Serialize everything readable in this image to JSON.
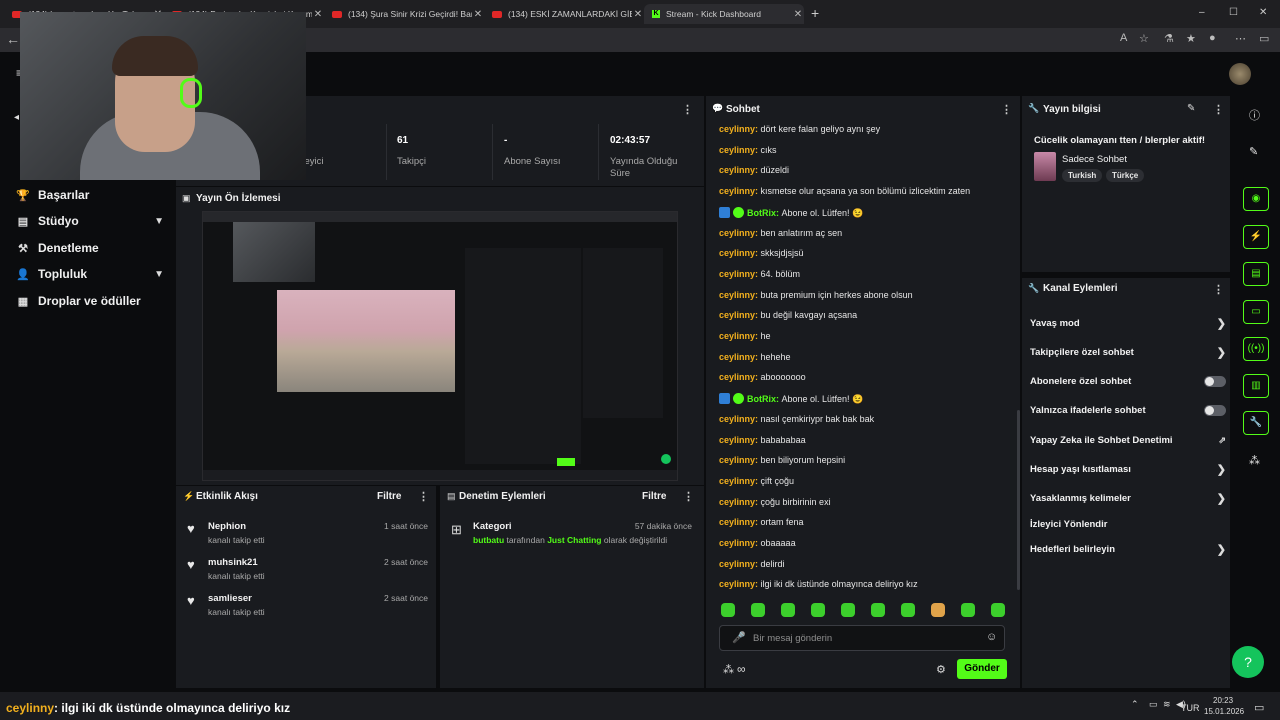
{
  "browser": {
    "tabs": [
      {
        "label": "(134) kısmetse olur - YouTube",
        "icon": "youtube-icon"
      },
      {
        "label": "(134) Perinaz'ın Kaprisleri Kerem'i",
        "icon": "youtube-icon"
      },
      {
        "label": "(134) Şura Sinir Krizi Geçirdi! Bard",
        "icon": "youtube-icon"
      },
      {
        "label": "(134) ESKİ ZAMANLARDAKİ GİBİ",
        "icon": "youtube-icon"
      },
      {
        "label": "Stream - Kick Dashboard",
        "icon": "kick-icon"
      }
    ],
    "new_tab": "+",
    "window_controls": [
      "–",
      "☐",
      "✕"
    ]
  },
  "sidebar": {
    "items": [
      {
        "label": "Başarılar",
        "icon": "trophy-icon",
        "expandable": false
      },
      {
        "label": "Stüdyo",
        "icon": "studio-icon",
        "expandable": true
      },
      {
        "label": "Denetleme",
        "icon": "hammer-icon",
        "expandable": false
      },
      {
        "label": "Topluluk",
        "icon": "community-icon",
        "expandable": true
      },
      {
        "label": "Droplar ve ödüller",
        "icon": "gift-icon",
        "expandable": false
      }
    ]
  },
  "stats": [
    {
      "value": "",
      "label": "İzleyici"
    },
    {
      "value": "61",
      "label": "Takipçi"
    },
    {
      "value": "-",
      "label": "Abone Sayısı"
    },
    {
      "value": "02:43:57",
      "label": "Yayında Olduğu Süre"
    }
  ],
  "preview": {
    "title": "Yayın Ön İzlemesi"
  },
  "activity": {
    "title": "Etkinlik Akışı",
    "filter": "Filtre",
    "events": [
      {
        "name": "Nephion",
        "action": "kanalı takip etti",
        "time": "1 saat önce"
      },
      {
        "name": "muhsink21",
        "action": "kanalı takip etti",
        "time": "2 saat önce"
      },
      {
        "name": "samlieser",
        "action": "kanalı takip etti",
        "time": "2 saat önce"
      }
    ]
  },
  "moderation": {
    "title": "Denetim Eylemleri",
    "filter": "Filtre",
    "entries": [
      {
        "title": "Kategori",
        "time": "57 dakika önce",
        "user": "butbatu",
        "mid": " tarafından ",
        "category": "Just Chatting",
        "tail": " olarak değiştirildi"
      }
    ]
  },
  "chat": {
    "title": "Sohbet",
    "messages": [
      {
        "user": "ceylinny",
        "text": "dört kere falan geliyo aynı şey"
      },
      {
        "user": "ceylinny",
        "text": "cıks"
      },
      {
        "user": "ceylinny",
        "text": "düzeldi"
      },
      {
        "user": "ceylinny",
        "text": "kısmetse olur açsana ya son bölümü izlicektim zaten"
      },
      {
        "user": "BotRix",
        "text": "Abone ol. Lütfen! 😉",
        "bot": true
      },
      {
        "user": "ceylinny",
        "text": "ben anlatırım aç sen"
      },
      {
        "user": "ceylinny",
        "text": "skksjdjsjsü"
      },
      {
        "user": "ceylinny",
        "text": "64. bölüm"
      },
      {
        "user": "ceylinny",
        "text": "buta premium için herkes abone olsun"
      },
      {
        "user": "ceylinny",
        "text": "bu değil kavgayı açsana"
      },
      {
        "user": "ceylinny",
        "text": "he"
      },
      {
        "user": "ceylinny",
        "text": "hehehe"
      },
      {
        "user": "ceylinny",
        "text": "abooooooo"
      },
      {
        "user": "BotRix",
        "text": "Abone ol. Lütfen! 😉",
        "bot": true
      },
      {
        "user": "ceylinny",
        "text": "nasıl çemkiriypr bak bak bak"
      },
      {
        "user": "ceylinny",
        "text": "babababaa"
      },
      {
        "user": "ceylinny",
        "text": "ben biliyorum hepsini"
      },
      {
        "user": "ceylinny",
        "text": "çift çoğu"
      },
      {
        "user": "ceylinny",
        "text": "çoğu birbirinin exi"
      },
      {
        "user": "ceylinny",
        "text": "ortam fena"
      },
      {
        "user": "ceylinny",
        "text": "obaaaaa"
      },
      {
        "user": "ceylinny",
        "text": "delirdi"
      },
      {
        "user": "ceylinny",
        "text": "ilgi iki dk üstünde olmayınca deliriyo kız"
      }
    ],
    "input_placeholder": "Bir mesaj gönderin",
    "send_label": "Gönder"
  },
  "stream_info": {
    "title": "Yayın bilgisi",
    "stream_title": "Cücelik olamayanı tten / blerpler aktif!",
    "category": "Sadece Sohbet",
    "tags": [
      "Turkish",
      "Türkçe"
    ]
  },
  "channel_actions": {
    "title": "Kanal Eylemleri",
    "items": [
      {
        "label": "Yavaş mod",
        "control": "arrow"
      },
      {
        "label": "Takipçilere özel sohbet",
        "control": "arrow"
      },
      {
        "label": "Abonelere özel sohbet",
        "control": "toggle",
        "on": false
      },
      {
        "label": "Yalnızca ifadelerle sohbet",
        "control": "toggle",
        "on": false
      },
      {
        "label": "Yapay Zeka ile Sohbet Denetimi",
        "control": "external"
      },
      {
        "label": "Hesap yaşı kısıtlaması",
        "control": "arrow"
      },
      {
        "label": "Yasaklanmış kelimeler",
        "control": "arrow"
      },
      {
        "label": "İzleyici Yönlendir",
        "control": "none"
      },
      {
        "label": "Hedefleri belirleyin",
        "control": "arrow"
      }
    ]
  },
  "overlay_caption": {
    "user": "ceylinny",
    "text": ": ilgi iki dk üstünde olmayınca deliriyo kız"
  },
  "taskbar": {
    "lang": "TUR",
    "time": "20:23",
    "date": "15.01.2026"
  },
  "colors": {
    "accent": "#53fc18",
    "username": "#f2b01e",
    "panel": "#191b1f",
    "background": "#0b0c0e"
  }
}
